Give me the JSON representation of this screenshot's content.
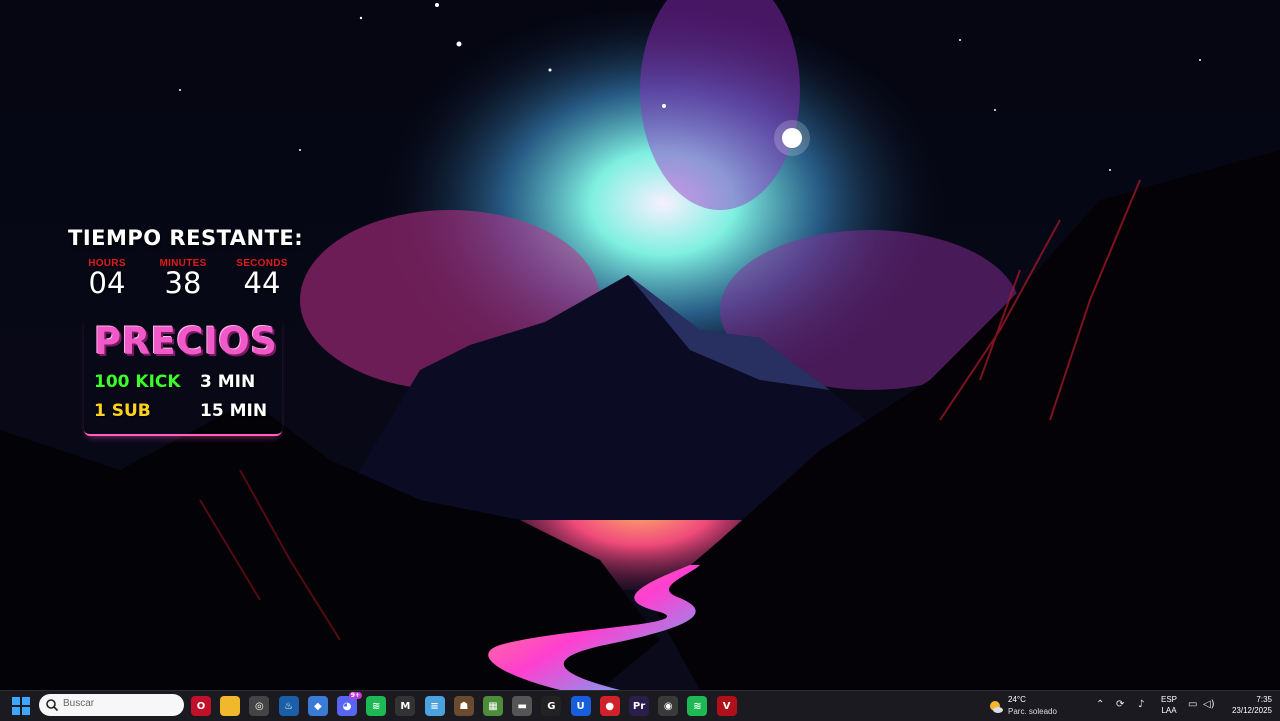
{
  "overlay": {
    "title": "TIEMPO RESTANTE:",
    "units": [
      {
        "label": "HOURS",
        "value": "04"
      },
      {
        "label": "MINUTES",
        "value": "38"
      },
      {
        "label": "SECONDS",
        "value": "44"
      }
    ],
    "prices_title": "PRECIOS",
    "prices": [
      {
        "item": "100 KICK",
        "time": "3 MIN",
        "color": "#3cff2e"
      },
      {
        "item": "1 SUB",
        "time": "15 MIN",
        "color": "#ffd21f"
      }
    ]
  },
  "taskbar": {
    "search_placeholder": "Buscar",
    "apps": [
      {
        "name": "opera-gx-icon",
        "glyph": "O",
        "bg": "#c0102a"
      },
      {
        "name": "file-explorer-icon",
        "glyph": "",
        "bg": "#f2b82c"
      },
      {
        "name": "chrome-like-icon",
        "glyph": "◎",
        "bg": "#444"
      },
      {
        "name": "steam-icon",
        "glyph": "♨",
        "bg": "#1b5fa8"
      },
      {
        "name": "shield-app-icon",
        "glyph": "◆",
        "bg": "#3a7bd5"
      },
      {
        "name": "discord-icon",
        "glyph": "◕",
        "bg": "#5865f2",
        "badge": "9+"
      },
      {
        "name": "spotify-icon",
        "glyph": "≋",
        "bg": "#1db954"
      },
      {
        "name": "pc-monitor-icon",
        "glyph": "M",
        "bg": "#333"
      },
      {
        "name": "notepad-icon",
        "glyph": "≡",
        "bg": "#4aa3df"
      },
      {
        "name": "game-app-icon",
        "glyph": "☗",
        "bg": "#6b4a2e"
      },
      {
        "name": "minecraft-icon",
        "glyph": "▦",
        "bg": "#4c8c3a"
      },
      {
        "name": "racing-game-icon",
        "glyph": "▬",
        "bg": "#555"
      },
      {
        "name": "g-app-icon",
        "glyph": "G",
        "bg": "#222"
      },
      {
        "name": "bitwarden-icon",
        "glyph": "U",
        "bg": "#175ddc"
      },
      {
        "name": "red-app-icon",
        "glyph": "●",
        "bg": "#d0202a"
      },
      {
        "name": "editor-app-icon",
        "glyph": "Pr",
        "bg": "#2a1f4a"
      },
      {
        "name": "obs-icon",
        "glyph": "◉",
        "bg": "#3a3a3a"
      },
      {
        "name": "spotify-icon-2",
        "glyph": "≋",
        "bg": "#1db954"
      },
      {
        "name": "voicemeeter-icon",
        "glyph": "V",
        "bg": "#b0101a"
      }
    ],
    "weather": {
      "temp": "24°C",
      "condition": "Parc. soleado"
    },
    "language": {
      "line1": "ESP",
      "line2": "LAA"
    },
    "clock": {
      "time": "7:35",
      "date": "23/12/2025"
    }
  }
}
